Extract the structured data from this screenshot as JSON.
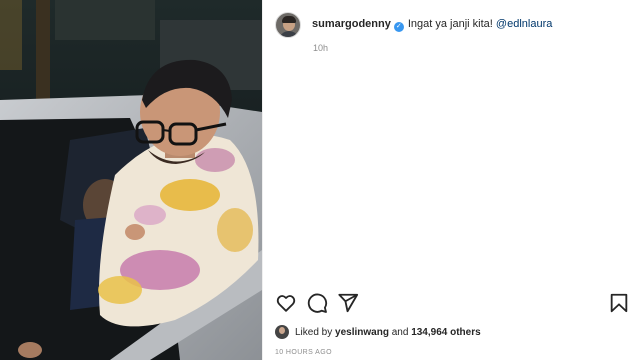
{
  "post": {
    "username": "sumargodenny",
    "verified_icon": "verified-badge-icon",
    "caption_text": "Ingat ya janji kita!",
    "mention": "@edlnlaura",
    "age": "10h"
  },
  "actions": {
    "like_icon": "heart-icon",
    "comment_icon": "comment-icon",
    "share_icon": "paper-plane-icon",
    "save_icon": "bookmark-icon"
  },
  "likes": {
    "prefix": "Liked by",
    "user": "yeslinwang",
    "joiner": "and",
    "others": "134,964 others"
  },
  "timestamp": "10 HOURS AGO",
  "colors": {
    "verified": "#3897f0",
    "mention": "#00376b",
    "muted": "#8e8e8e"
  }
}
